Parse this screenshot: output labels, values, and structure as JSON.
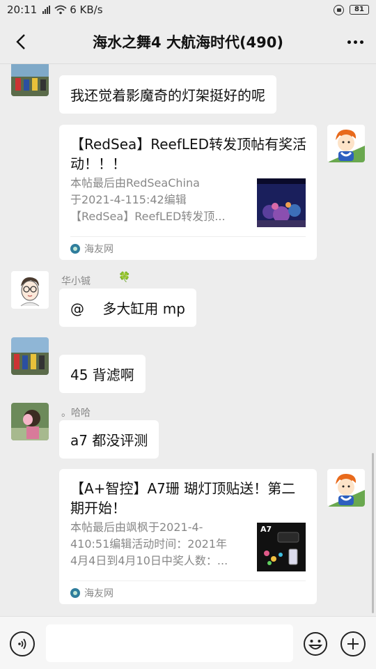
{
  "status": {
    "time": "20:11",
    "speed": "6 KB/s",
    "battery": "81"
  },
  "header": {
    "title": "海水之舞4 大航海时代(490)"
  },
  "messages": {
    "m1": {
      "text": "我还觉着影魔奇的灯架挺好的呢"
    },
    "card1": {
      "title": "【RedSea】ReefLED转发顶帖有奖活动！！！",
      "desc1": "本帖最后由RedSeaChina",
      "desc2": "于2021-4-115:42编辑",
      "desc3": "【RedSea】ReefLED转发顶...",
      "source": "海友网"
    },
    "m2": {
      "sender": "华小铖",
      "sender_emoji": "🍀",
      "text": "@　 多大缸用 mp"
    },
    "m3": {
      "text": "45 背滤啊"
    },
    "m4": {
      "sender": "。哈哈",
      "text": "a7 都没评测"
    },
    "card2": {
      "title": "【A+智控】A7珊 瑚灯顶贴送！第二期开始！",
      "desc1": "本帖最后由飒枫于2021-4-",
      "desc2": "410:51编辑活动时间：2021年",
      "desc3": "4月4日到4月10日中奖人数：...",
      "source": "海友网",
      "thumb_label": "A7"
    }
  },
  "input": {
    "value": ""
  }
}
